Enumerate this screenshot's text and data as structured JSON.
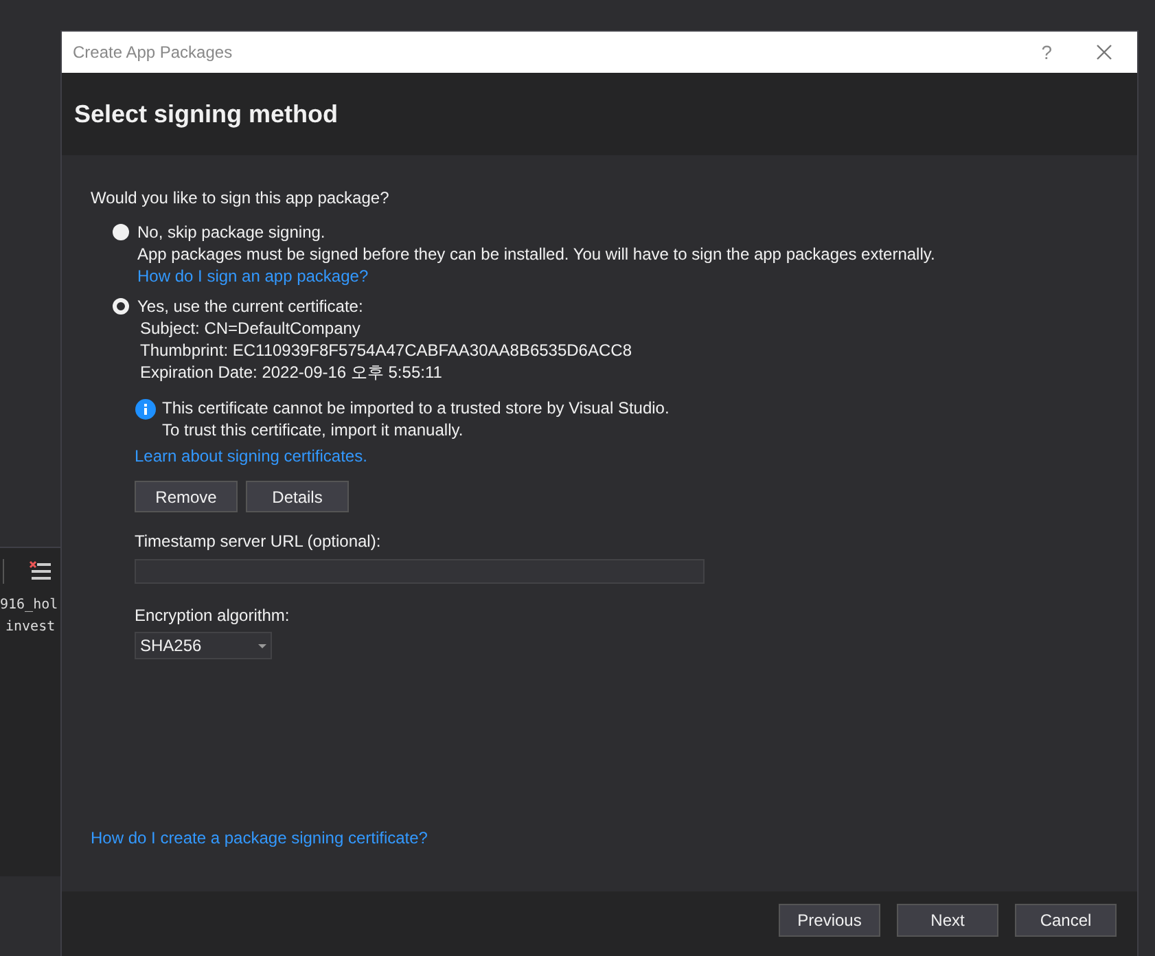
{
  "background": {
    "texts": [
      "916_hol",
      "invest"
    ]
  },
  "window": {
    "title": "Create App Packages",
    "help": "?"
  },
  "header": {
    "title": "Select signing method"
  },
  "question": "Would you like to sign this app package?",
  "options": [
    {
      "label": "No, skip package signing.",
      "selected": false,
      "details": [
        "App packages must be signed before they can be installed. You will have to sign the app packages externally."
      ],
      "link": "How do I sign an app package?"
    },
    {
      "label": "Yes, use the current certificate:",
      "selected": true,
      "details": [
        "Subject: CN=DefaultCompany",
        "Thumbprint: EC110939F8F5754A47CABFAA30AA8B6535D6ACC8",
        "Expiration Date: 2022-09-16 오후 5:55:11"
      ]
    }
  ],
  "info": {
    "lines": [
      "This certificate cannot be imported to a trusted store by Visual Studio.",
      "To trust this certificate, import it manually."
    ],
    "link": "Learn about signing certificates."
  },
  "cert_buttons": [
    "Remove",
    "Details"
  ],
  "timestamp": {
    "label": "Timestamp server URL (optional):"
  },
  "encryption": {
    "label": "Encryption algorithm:",
    "value": "SHA256"
  },
  "help_link": "How do I create a package signing certificate?",
  "buttons": [
    "Previous",
    "Next",
    "Cancel"
  ]
}
